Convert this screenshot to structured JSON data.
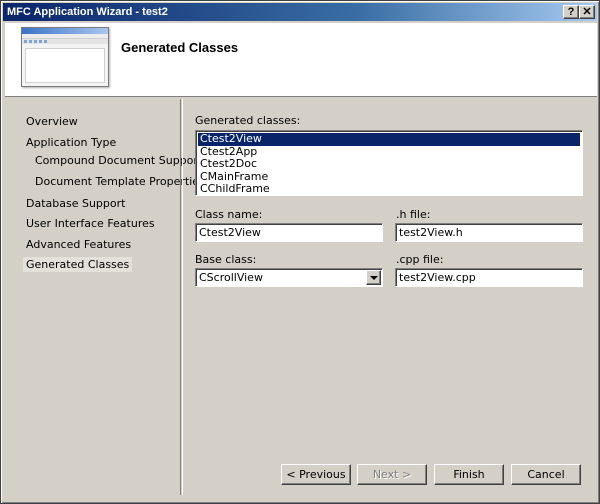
{
  "window": {
    "title": "MFC Application Wizard - test2",
    "help_label": "?",
    "close_label": "✕"
  },
  "banner": {
    "title": "Generated Classes",
    "icon": "app-preview-icon"
  },
  "sidebar": {
    "items": [
      {
        "label": "Overview"
      },
      {
        "label": "Application Type"
      },
      {
        "label": "Compound Document Support"
      },
      {
        "label": "Document Template Properties"
      },
      {
        "label": "Database Support"
      },
      {
        "label": "User Interface Features"
      },
      {
        "label": "Advanced Features"
      },
      {
        "label": "Generated Classes",
        "selected": true
      }
    ]
  },
  "main": {
    "generated_classes_label": "Generated classes:",
    "classes": [
      "Ctest2View",
      "Ctest2App",
      "Ctest2Doc",
      "CMainFrame",
      "CChildFrame"
    ],
    "selected_class": "Ctest2View",
    "class_name_label": "Class name:",
    "class_name_value": "Ctest2View",
    "h_file_label": ".h file:",
    "h_file_value": "test2View.h",
    "base_class_label": "Base class:",
    "base_class_value": "CScrollView",
    "cpp_file_label": ".cpp file:",
    "cpp_file_value": "test2View.cpp"
  },
  "buttons": {
    "previous": "< Previous",
    "next": "Next >",
    "finish": "Finish",
    "cancel": "Cancel"
  },
  "colors": {
    "selection": "#0a246a",
    "dialog_face": "#d4d0c8"
  }
}
